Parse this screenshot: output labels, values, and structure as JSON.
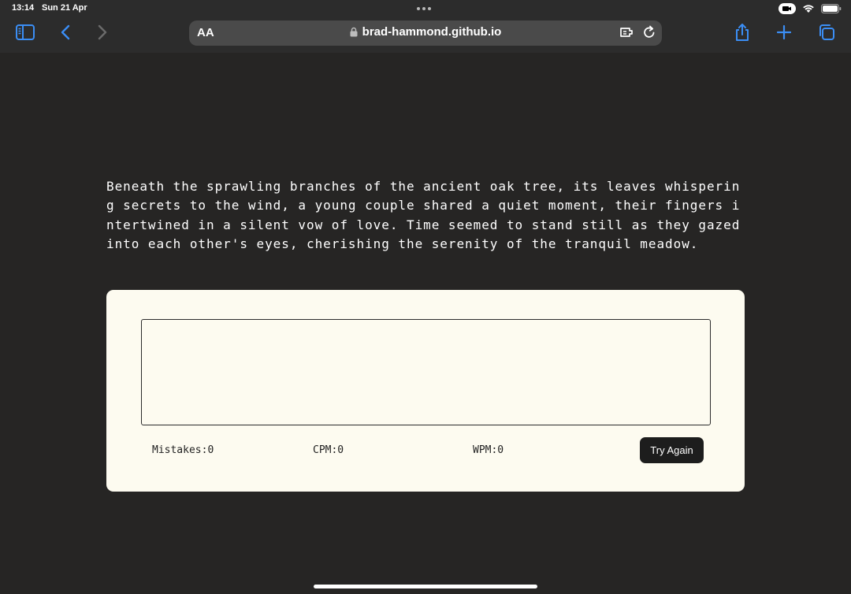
{
  "status_bar": {
    "time": "13:14",
    "date": "Sun 21 Apr"
  },
  "browser": {
    "text_size_label": "AA",
    "url": "brad-hammond.github.io",
    "accent_color": "#3b8ef5"
  },
  "page": {
    "paragraph": "Beneath the sprawling branches of the ancient oak tree, its leaves whispering secrets to the wind, a young couple shared a quiet moment, their fingers intertwined in a silent vow of love. Time seemed to stand still as they gazed into each other's eyes, cherishing the serenity of the tranquil meadow.",
    "typing_input_value": "",
    "stats": {
      "mistakes": "Mistakes:0",
      "cpm": "CPM:0",
      "wpm": "WPM:0"
    },
    "try_again_label": "Try Again",
    "colors": {
      "background": "#262524",
      "card": "#fdfbf0",
      "button": "#1d1d1d"
    }
  }
}
